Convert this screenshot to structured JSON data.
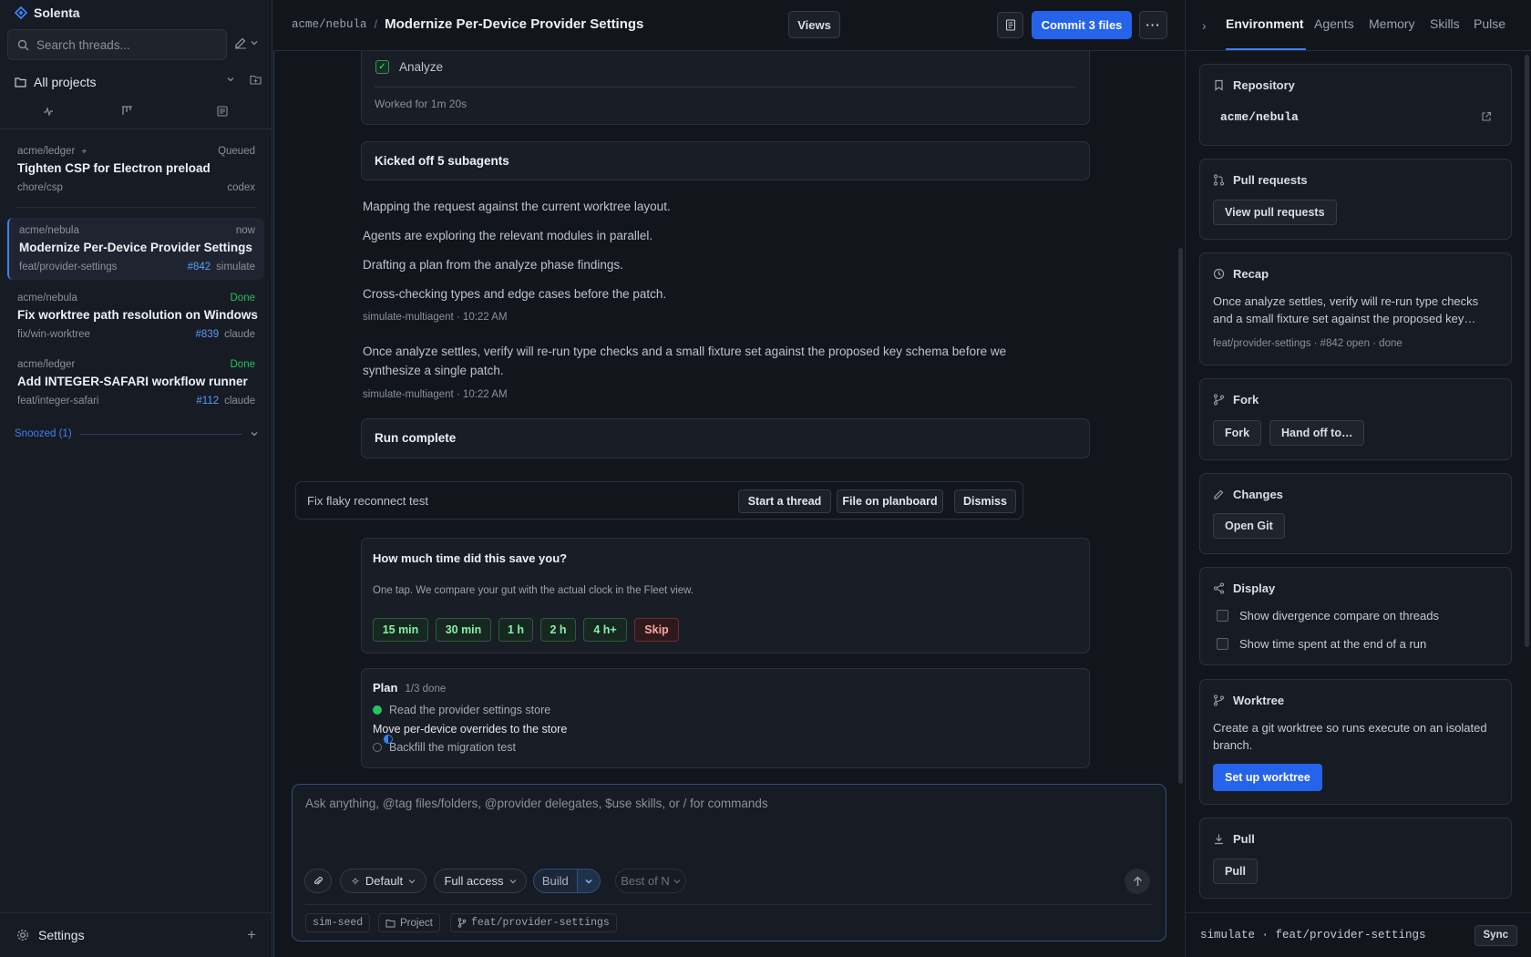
{
  "app": {
    "name": "Solenta"
  },
  "sidebar": {
    "search_placeholder": "Search threads...",
    "projects_label": "All projects",
    "threads": [
      {
        "repo": "acme/ledger",
        "status": "Queued",
        "title": "Tighten CSP for Electron preload",
        "branch": "chore/csp",
        "pr": "",
        "agent": "codex"
      },
      {
        "repo": "acme/nebula",
        "status": "now",
        "title": "Modernize Per-Device Provider Settings",
        "branch": "feat/provider-settings",
        "pr": "#842",
        "agent": "simulate"
      },
      {
        "repo": "acme/nebula",
        "status": "Done",
        "title": "Fix worktree path resolution on Windows",
        "branch": "fix/win-worktree",
        "pr": "#839",
        "agent": "claude"
      },
      {
        "repo": "acme/ledger",
        "status": "Done",
        "title": "Add INTEGER-SAFARI workflow runner",
        "branch": "feat/integer-safari",
        "pr": "#112",
        "agent": "claude"
      }
    ],
    "snoozed_label": "Snoozed (1)",
    "settings_label": "Settings"
  },
  "topbar": {
    "repo": "acme/nebula",
    "separator": "/",
    "title": "Modernize Per-Device Provider Settings",
    "views_label": "Views",
    "commit_label": "Commit 3 files",
    "more_label": "···"
  },
  "main": {
    "analyze_label": "Analyze",
    "worked_label": "Worked for 1m 20s",
    "subagents_label": "Kicked off 5 subagents",
    "messages": [
      "Mapping the request against the current worktree layout.",
      "Agents are exploring the relevant modules in parallel.",
      "Drafting a plan from the analyze phase findings.",
      "Cross-checking types and edge cases before the patch."
    ],
    "meta1": "simulate-multiagent · 10:22 AM",
    "verify_message": "Once analyze settles, verify will re-run type checks and a small fixture set against the proposed key schema before we synthesize a single patch.",
    "meta2": "simulate-multiagent · 10:22 AM",
    "run_complete_label": "Run complete",
    "suggestion": {
      "text": "Fix flaky reconnect test",
      "start_label": "Start a thread",
      "file_label": "File on planboard",
      "dismiss_label": "Dismiss"
    },
    "time_saved": {
      "question": "How much time did this save you?",
      "description": "One tap. We compare your gut with the actual clock in the Fleet view.",
      "options": [
        "15 min",
        "30 min",
        "1 h",
        "2 h",
        "4 h+"
      ],
      "skip_label": "Skip"
    },
    "plan": {
      "title": "Plan",
      "progress": "1/3 done",
      "items": [
        {
          "label": "Read the provider settings store",
          "state": "done"
        },
        {
          "label": "Move per-device overrides to the store",
          "state": "in-progress"
        },
        {
          "label": "Backfill the migration test",
          "state": "todo"
        }
      ]
    },
    "composer": {
      "placeholder": "Ask anything, @tag files/folders, @provider delegates, $use skills, or / for commands",
      "mode_label": "Default",
      "access_label": "Full access",
      "build_label": "Build",
      "bestn_label": "Best of N",
      "chips": [
        "sim-seed",
        "Project",
        "feat/provider-settings"
      ]
    }
  },
  "right": {
    "tabs": [
      "Environment",
      "Agents",
      "Memory",
      "Skills",
      "Pulse"
    ],
    "active_tab": "Environment",
    "repository": {
      "title": "Repository",
      "value": "acme/nebula"
    },
    "pull_requests": {
      "title": "Pull requests",
      "button": "View pull requests"
    },
    "recap": {
      "title": "Recap",
      "text": "Once analyze settles, verify will re-run type checks and a small fixture set against the proposed key…",
      "meta": "feat/provider-settings · #842 open · done"
    },
    "fork": {
      "title": "Fork",
      "fork_button": "Fork",
      "handoff_button": "Hand off to…"
    },
    "changes": {
      "title": "Changes",
      "button": "Open Git"
    },
    "display": {
      "title": "Display",
      "options": [
        "Show divergence compare on threads",
        "Show time spent at the end of a run"
      ]
    },
    "worktree": {
      "title": "Worktree",
      "text": "Create a git worktree so runs execute on an isolated branch.",
      "button": "Set up worktree"
    },
    "pull": {
      "title": "Pull",
      "button": "Pull"
    },
    "footer": {
      "text": "simulate · feat/provider-settings",
      "sync_label": "Sync"
    }
  },
  "colors": {
    "accent": "#2563eb",
    "done": "#22c55e",
    "background": "#12151c"
  }
}
